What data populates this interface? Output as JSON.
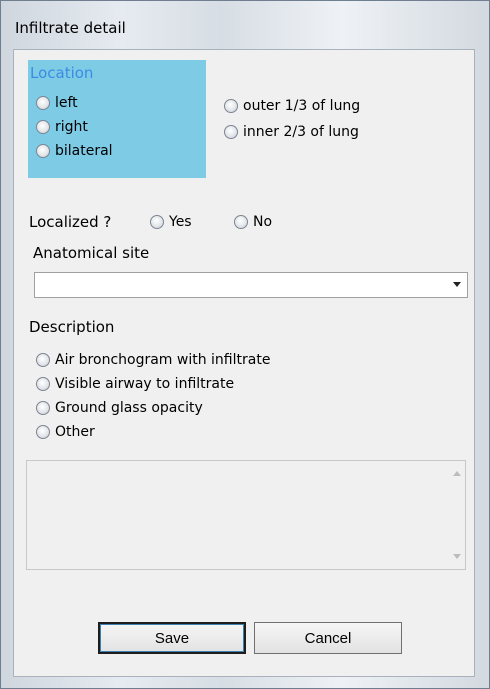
{
  "window": {
    "title": "Infiltrate detail"
  },
  "location": {
    "label": "Location",
    "side_options": [
      "left",
      "right",
      "bilateral"
    ],
    "extent_options": [
      "outer 1/3 of lung",
      "inner 2/3 of lung"
    ]
  },
  "localized": {
    "label": "Localized ?",
    "yes_label": "Yes",
    "no_label": "No"
  },
  "anatomical_site": {
    "label": "Anatomical site",
    "value": ""
  },
  "description": {
    "label": "Description",
    "options": [
      "Air bronchogram with infiltrate",
      "Visible airway to infiltrate",
      "Ground glass opacity",
      "Other"
    ],
    "other_text": ""
  },
  "buttons": {
    "save_label": "Save",
    "cancel_label": "Cancel"
  },
  "colors": {
    "location_panel": "#7ecbe6",
    "location_label": "#3b8be3",
    "dialog_bg": "#f0f0f0"
  }
}
